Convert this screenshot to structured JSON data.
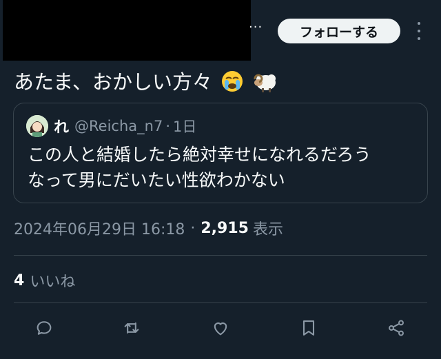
{
  "header": {
    "more_glyph": "···",
    "follow_label": "フォローする"
  },
  "tweet": {
    "text": "あたま、おかしい方々",
    "emojis": [
      "crying-face-emoji",
      "ram-emoji"
    ]
  },
  "quoted": {
    "name": "れ",
    "handle": "@Reicha_n7",
    "separator": "·",
    "time": "1日",
    "line1": "この人と結婚したら絶対幸せになれるだろう",
    "line2": "なって男にだいたい性欲わかない"
  },
  "meta": {
    "datetime": "2024年06月29日 16:18",
    "separator": "·",
    "views_count": "2,915",
    "views_label": "表示"
  },
  "stats": {
    "likes_count": "4",
    "likes_label": "いいね"
  },
  "actions": [
    "reply-icon",
    "retweet-icon",
    "like-icon",
    "bookmark-icon",
    "share-icon"
  ],
  "colors": {
    "background": "#15202b",
    "text": "#f7f9f9",
    "secondary": "#8b98a5",
    "border": "#38444d",
    "follow_bg": "#eff3f4"
  }
}
